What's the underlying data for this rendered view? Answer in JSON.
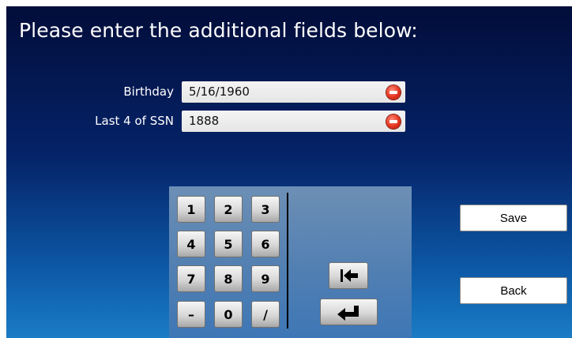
{
  "title": "Please enter the additional fields below:",
  "fields": [
    {
      "label": "Birthday",
      "value": "5/16/1960"
    },
    {
      "label": "Last 4 of SSN",
      "value": "1888"
    }
  ],
  "keypad": {
    "keys": [
      "1",
      "2",
      "3",
      "4",
      "5",
      "6",
      "7",
      "8",
      "9",
      "–",
      "0",
      "/"
    ],
    "tab_icon": "tab-back-icon",
    "enter_icon": "enter-icon"
  },
  "buttons": {
    "save": "Save",
    "back": "Back"
  }
}
